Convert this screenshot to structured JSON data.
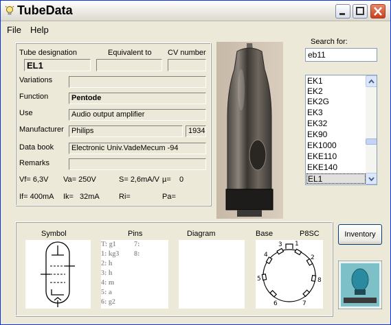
{
  "window": {
    "title": "TubeData",
    "menu": [
      "File",
      "Help"
    ]
  },
  "tube": {
    "designation_label": "Tube designation",
    "equivalent_label": "Equivalent to",
    "cv_label": "CV number",
    "designation": "EL1",
    "equivalent": "",
    "cv_number": "",
    "variations_label": "Variations",
    "variations": "",
    "function_label": "Function",
    "function": "Pentode",
    "use_label": "Use",
    "use": "Audio output amplifier",
    "manufacturer_label": "Manufacturer",
    "manufacturer": "Philips",
    "year": "1934",
    "databook_label": "Data book",
    "databook": "Electronic Univ.VadeMecum -94",
    "remarks_label": "Remarks",
    "remarks": "",
    "params": {
      "vf": "Vf= 6,3V",
      "va": "Va= 250V",
      "s": "S= 2,6mA/V",
      "mu": "µ=",
      "mu_value": "0",
      "if": "If= 400mA",
      "ik": "Ik=",
      "ik_value": "32mA",
      "ri": "Ri=",
      "pa": "Pa="
    }
  },
  "search": {
    "label": "Search for:",
    "value": "eb11",
    "results": [
      "EK1",
      "EK2",
      "EK2G",
      "EK3",
      "EK32",
      "EK90",
      "EK1000",
      "EKE110",
      "EKE140",
      "EL1"
    ],
    "selected": "EL1"
  },
  "inventory_label": "Inventory",
  "bottom": {
    "symbol_label": "Symbol",
    "pins_label": "Pins",
    "diagram_label": "Diagram",
    "base_label": "Base",
    "base_code": "P8SC",
    "pins_col1": [
      "T: g1",
      "1: kg3",
      "2: h",
      "3: h",
      "4: m",
      "5: a",
      "6: g2"
    ],
    "pins_col2": [
      "7:",
      "8:"
    ],
    "base_pin_numbers": [
      "1",
      "2",
      "3",
      "4",
      "5",
      "6",
      "7",
      "8"
    ]
  }
}
